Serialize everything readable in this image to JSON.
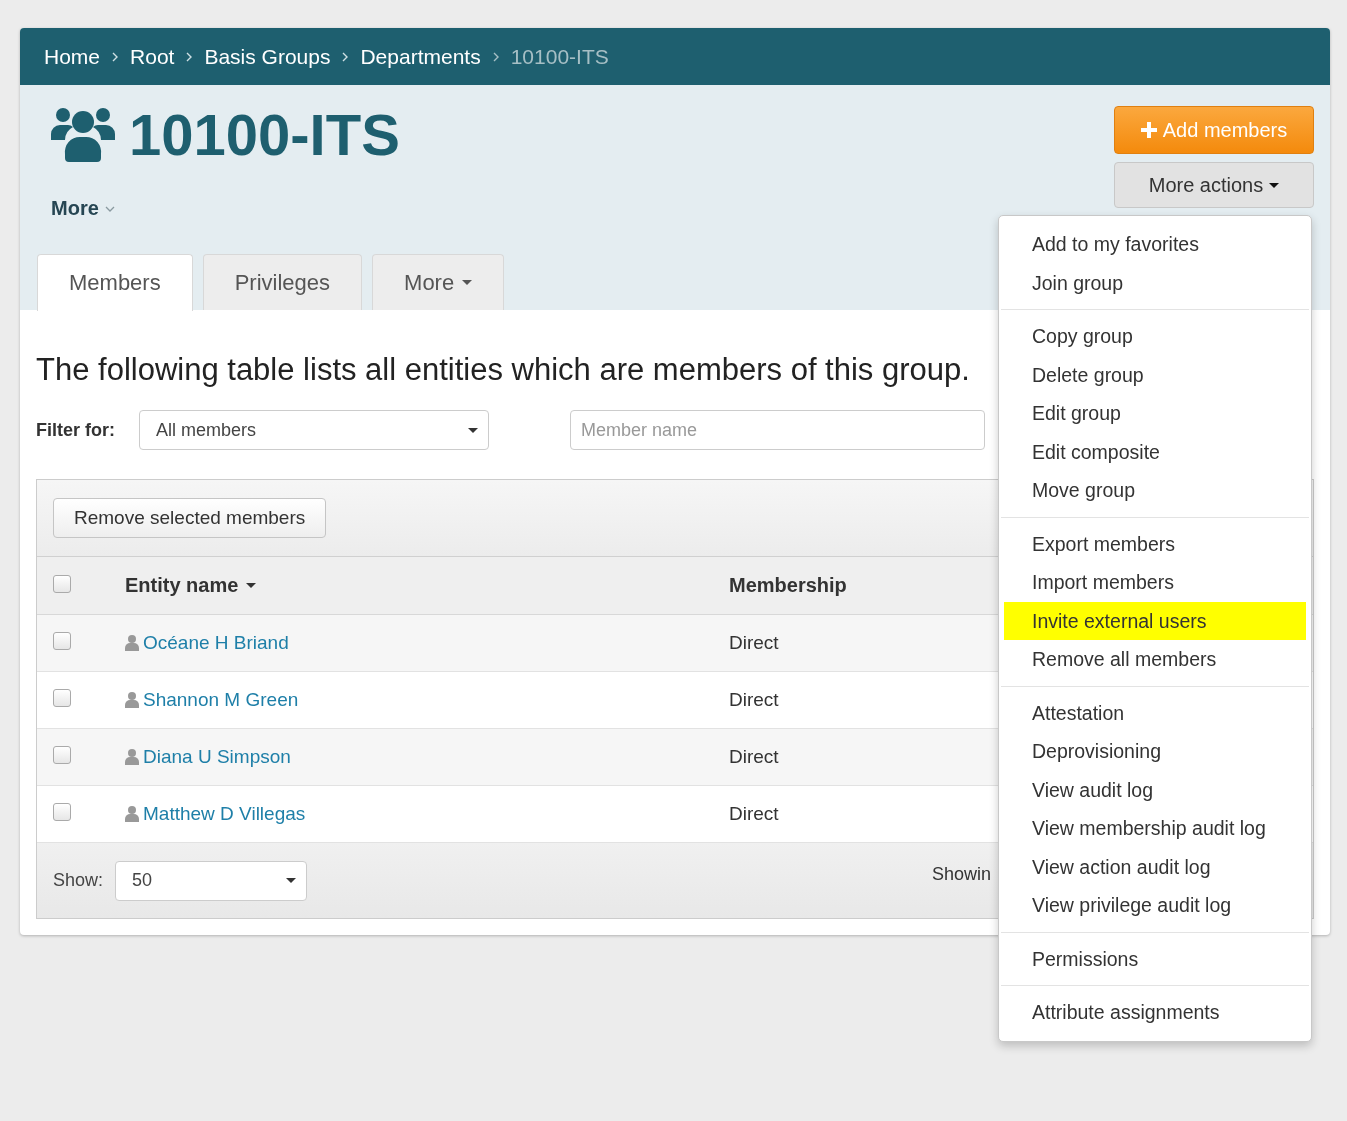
{
  "breadcrumb": [
    {
      "label": "Home",
      "current": false
    },
    {
      "label": "Root",
      "current": false
    },
    {
      "label": "Basis Groups",
      "current": false
    },
    {
      "label": "Departments",
      "current": false
    },
    {
      "label": "10100-ITS",
      "current": true
    }
  ],
  "title": "10100-ITS",
  "more_link": "More",
  "buttons": {
    "add_members": "Add members",
    "more_actions": "More actions"
  },
  "tabs": [
    {
      "label": "Members",
      "selected": true,
      "dropdown": false
    },
    {
      "label": "Privileges",
      "selected": false,
      "dropdown": false
    },
    {
      "label": "More",
      "selected": false,
      "dropdown": true
    }
  ],
  "description": "The following table lists all entities which are members of this group.",
  "filter": {
    "label": "Filter for:",
    "value": "All members",
    "search_placeholder": "Member name"
  },
  "toolbar_button": "Remove selected members",
  "table": {
    "select_all_checked": false,
    "columns": [
      "Entity name",
      "Membership"
    ],
    "rows": [
      {
        "name": "Océane H Briand",
        "membership": "Direct",
        "checked": false
      },
      {
        "name": "Shannon M Green",
        "membership": "Direct",
        "checked": false
      },
      {
        "name": "Diana U Simpson",
        "membership": "Direct",
        "checked": false
      },
      {
        "name": "Matthew D Villegas",
        "membership": "Direct",
        "checked": false
      }
    ]
  },
  "footer": {
    "show_label": "Show:",
    "page_size": "50",
    "summary": "Showin"
  },
  "menu": {
    "sections": [
      [
        {
          "label": "Add to my favorites",
          "highlighted": false
        },
        {
          "label": "Join group",
          "highlighted": false
        }
      ],
      [
        {
          "label": "Copy group",
          "highlighted": false
        },
        {
          "label": "Delete group",
          "highlighted": false
        },
        {
          "label": "Edit group",
          "highlighted": false
        },
        {
          "label": "Edit composite",
          "highlighted": false
        },
        {
          "label": "Move group",
          "highlighted": false
        }
      ],
      [
        {
          "label": "Export members",
          "highlighted": false
        },
        {
          "label": "Import members",
          "highlighted": false
        },
        {
          "label": "Invite external users",
          "highlighted": true
        },
        {
          "label": "Remove all members",
          "highlighted": false
        }
      ],
      [
        {
          "label": "Attestation",
          "highlighted": false
        },
        {
          "label": "Deprovisioning",
          "highlighted": false
        },
        {
          "label": "View audit log",
          "highlighted": false
        },
        {
          "label": "View membership audit log",
          "highlighted": false
        },
        {
          "label": "View action audit log",
          "highlighted": false
        },
        {
          "label": "View privilege audit log",
          "highlighted": false
        }
      ],
      [
        {
          "label": "Permissions",
          "highlighted": false
        }
      ],
      [
        {
          "label": "Attribute assignments",
          "highlighted": false
        }
      ]
    ]
  }
}
